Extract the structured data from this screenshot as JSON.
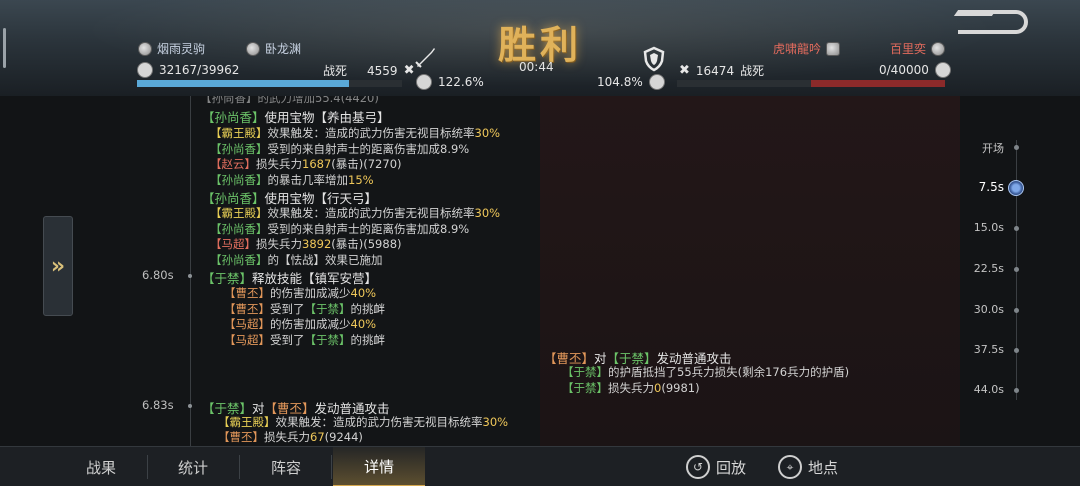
{
  "header": {
    "left_players": [
      "烟雨灵驹",
      "卧龙渊"
    ],
    "right_players": [
      "虎啸龍吟",
      "百里奕"
    ],
    "left_troops": "32167/39962",
    "left_dead_label": "战死",
    "left_dead": "4559",
    "right_troops": "0/40000",
    "right_dead_label": "战死",
    "right_dead": "16474",
    "victory": "胜利",
    "timer": "00:44",
    "left_percent": "122.6%",
    "right_percent": "104.8%",
    "left_bar_fraction": 0.8,
    "right_bar_fraction": 0.5,
    "colors": {
      "left_bar": "#5aa9d8",
      "right_bar": "#8c2a2a",
      "victory": "#e0b25a"
    }
  },
  "log": {
    "top_cut": "【孙尚香】的武力增加55.4(4420)",
    "entries": [
      {
        "main": {
          "pre": "【孙尚香】",
          "rest": "使用宝物【养由基弓】"
        },
        "subs": [
          {
            "name": "【霸王殿】",
            "text": "效果触发：造成的武力伤害无视目标统率",
            "num": "30%"
          },
          {
            "name": "【孙尚香】",
            "text": "受到的来自射声士的距离伤害加成8.9%"
          },
          {
            "name": "【赵云】",
            "text": "损失兵力",
            "num": "1687",
            "tail": "(暴击)(7270)"
          },
          {
            "name": "【孙尚香】",
            "text": "的暴击几率增加",
            "num": "15%"
          }
        ]
      },
      {
        "main": {
          "pre": "【孙尚香】",
          "rest": "使用宝物【行天弓】"
        },
        "subs": [
          {
            "name": "【霸王殿】",
            "text": "效果触发：造成的武力伤害无视目标统率",
            "num": "30%"
          },
          {
            "name": "【孙尚香】",
            "text": "受到的来自射声士的距离伤害加成8.9%"
          },
          {
            "name": "【马超】",
            "text": "损失兵力",
            "num": "3892",
            "tail": "(暴击)(5988)"
          },
          {
            "name": "【孙尚香】",
            "text": "的【怯战】效果已施加"
          }
        ]
      },
      {
        "time": "6.80s",
        "main": {
          "pre": "【于禁】",
          "rest": "释放技能【镇军安营】"
        },
        "subs": [
          {
            "name": "【曹丕】",
            "text": "的伤害加成减少",
            "num": "40%"
          },
          {
            "name": "【曹丕】",
            "text": "受到了",
            "name2": "【于禁】",
            "text2": "的挑衅"
          },
          {
            "name": "【马超】",
            "text": "的伤害加成减少",
            "num": "40%"
          },
          {
            "name": "【马超】",
            "text": "受到了",
            "name2": "【于禁】",
            "text2": "的挑衅"
          }
        ]
      },
      {
        "main": {
          "pre": "【曹丕】",
          "mid": "对",
          "pre2": "【于禁】",
          "rest": "发动普通攻击"
        },
        "subs": [
          {
            "name": "【于禁】",
            "text": "的护盾抵挡了55兵力损失(剩余176兵力的护盾)"
          },
          {
            "name": "【于禁】",
            "text": "损失兵力",
            "num": "0",
            "tail": "(9981)"
          }
        ]
      },
      {
        "time": "6.83s",
        "main": {
          "pre": "【于禁】",
          "mid": "对",
          "pre2": "【曹丕】",
          "rest": "发动普通攻击"
        },
        "subs": [
          {
            "name": "【霸王殿】",
            "text": "效果触发：造成的武力伤害无视目标统率",
            "num": "30%"
          },
          {
            "name": "【曹丕】",
            "text": "损失兵力",
            "num": "67",
            "tail": "(9244)"
          }
        ]
      }
    ]
  },
  "timeline": {
    "items": [
      "开场",
      "7.5s",
      "15.0s",
      "22.5s",
      "30.0s",
      "37.5s",
      "44.0s"
    ],
    "active": "7.5s"
  },
  "expand_button": {
    "icon": "double-chevron-right-icon",
    "label": "»"
  },
  "bottom": {
    "tabs": [
      "战果",
      "统计",
      "阵容",
      "详情"
    ],
    "active_tab": "详情",
    "replay_label": "回放",
    "location_label": "地点"
  }
}
